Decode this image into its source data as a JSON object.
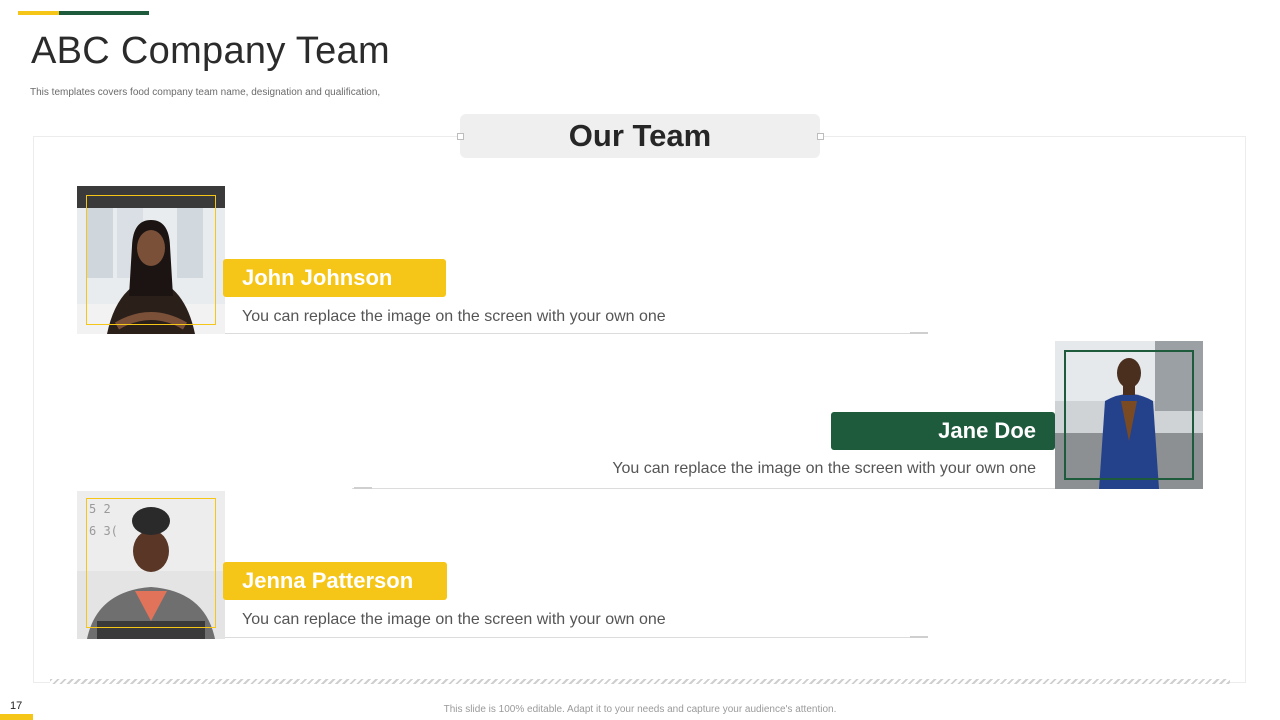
{
  "slide": {
    "title": "ABC Company Team",
    "subtitle": "This templates covers food company team name, designation and qualification,",
    "section_heading": "Our Team",
    "page_number": "17",
    "footer": "This slide is 100% editable. Adapt it to your needs and capture your audience's attention."
  },
  "team": [
    {
      "name": "John Johnson",
      "description": "You can replace the image on the screen with your own one",
      "accent": "yellow"
    },
    {
      "name": "Jane Doe",
      "description": "You can replace the image on the screen with your own one",
      "accent": "green"
    },
    {
      "name": "Jenna Patterson",
      "description": "You can replace the image on the screen with your own one",
      "accent": "yellow"
    }
  ],
  "colors": {
    "accent_yellow": "#f5c518",
    "accent_green": "#1e5a3c",
    "heading_box": "#efefef",
    "title_text": "#2b2b2b"
  },
  "icons": [
    "person-photo-icon"
  ]
}
